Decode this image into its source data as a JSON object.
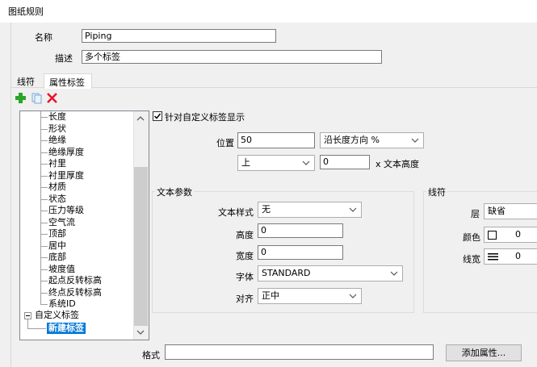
{
  "window": {
    "title": "图纸规则"
  },
  "form": {
    "name_label": "名称",
    "name_value": "Piping",
    "desc_label": "描述",
    "desc_value": "多个标签"
  },
  "tabs": [
    {
      "label": "线符",
      "active": false
    },
    {
      "label": "属性标签",
      "active": true
    }
  ],
  "toolbar": {
    "add_icon": "plus-icon",
    "copy_icon": "copy-icon",
    "delete_icon": "delete-x-icon"
  },
  "tree": {
    "items": [
      "长度",
      "形状",
      "绝缘",
      "绝缘厚度",
      "衬里",
      "衬里厚度",
      "材质",
      "状态",
      "压力等级",
      "空气流",
      "顶部",
      "居中",
      "底部",
      "坡度值",
      "起点反转标高",
      "终点反转标高",
      "系统ID"
    ],
    "group_label": "自定义标签",
    "selected_child": "新建标签"
  },
  "custom_label": {
    "checkbox_label": "针对自定义标签显示",
    "checked": true,
    "position_label": "位置",
    "position_value": "50",
    "position_mode": "沿长度方向 %",
    "offset_dir": "上",
    "offset_value": "0",
    "offset_unit": "x 文本高度"
  },
  "text_params": {
    "title": "文本参数",
    "style_label": "文本样式",
    "style_value": "无",
    "height_label": "高度",
    "height_value": "0",
    "width_label": "宽度",
    "width_value": "0",
    "font_label": "字体",
    "font_value": "STANDARD",
    "align_label": "对齐",
    "align_value": "正中"
  },
  "line_style": {
    "title": "线符",
    "layer_label": "层",
    "layer_value": "缺省",
    "color_label": "颜色",
    "color_value": "0",
    "lineweight_label": "线宽",
    "lineweight_value": "0"
  },
  "format": {
    "label": "格式",
    "value": "",
    "add_attr_button": "添加属性..."
  },
  "colors": {
    "accent_select": "#0078d7",
    "add_green": "#2aa52a",
    "delete_red": "#e81123"
  }
}
